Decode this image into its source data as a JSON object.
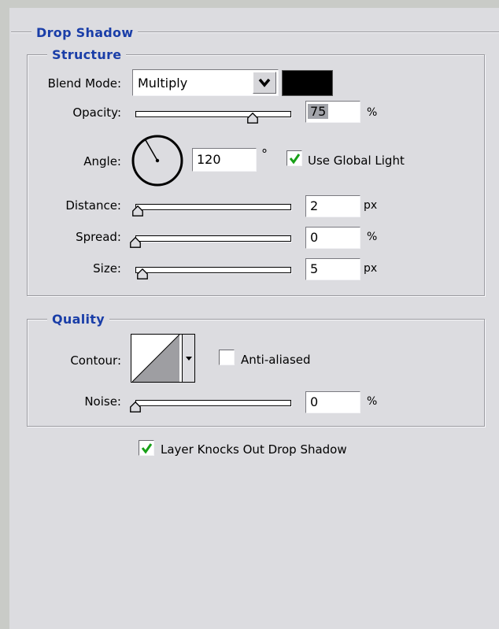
{
  "dialog": {
    "title": "Drop Shadow"
  },
  "structure": {
    "title": "Structure",
    "blend_mode": {
      "label": "Blend Mode:",
      "value": "Multiply",
      "shadow_color": "#000000"
    },
    "opacity": {
      "label": "Opacity:",
      "value": "75",
      "unit": "%",
      "level": 0.75
    },
    "angle": {
      "label": "Angle:",
      "value": "120",
      "unit": "°",
      "degrees": 120
    },
    "use_global_light": {
      "label": "Use Global Light",
      "checked": true
    },
    "distance": {
      "label": "Distance:",
      "value": "2",
      "unit": "px",
      "level": 0.02
    },
    "spread": {
      "label": "Spread:",
      "value": "0",
      "unit": "%",
      "level": 0.0
    },
    "size": {
      "label": "Size:",
      "value": "5",
      "unit": "px",
      "level": 0.04
    }
  },
  "quality": {
    "title": "Quality",
    "contour": {
      "label": "Contour:"
    },
    "anti_aliased": {
      "label": "Anti-aliased",
      "checked": false
    },
    "noise": {
      "label": "Noise:",
      "value": "0",
      "unit": "%",
      "level": 0.0
    }
  },
  "layer_knocks_out": {
    "label": "Layer Knocks Out Drop Shadow",
    "checked": true
  },
  "colors": {
    "accent": "#1a3ea8",
    "check": "#18a018",
    "panel": "#dcdce0"
  }
}
